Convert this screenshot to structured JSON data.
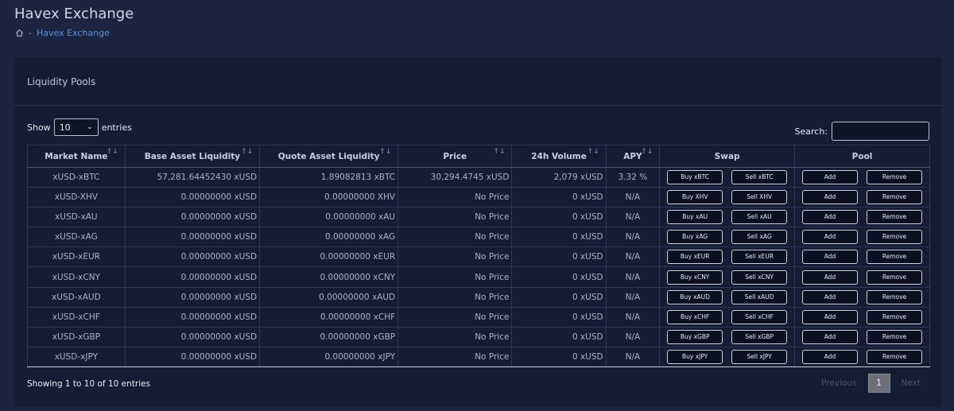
{
  "page": {
    "title": "Havex Exchange"
  },
  "breadcrumb": {
    "home_icon": "home-icon",
    "separator": "-",
    "current": "Havex Exchange"
  },
  "card": {
    "title": "Liquidity Pools"
  },
  "length": {
    "show_label": "Show",
    "value": "10",
    "entries_label": "entries"
  },
  "search": {
    "label": "Search:",
    "value": ""
  },
  "table": {
    "headers": [
      "Market Name",
      "Base Asset Liquidity",
      "Quote Asset Liquidity",
      "Price",
      "24h Volume",
      "APY",
      "Swap",
      "Pool"
    ],
    "sort_glyphs": [
      "↑↓",
      "↑↓",
      "↑↓",
      "↑↓",
      "↑↓",
      "↑↓"
    ],
    "rows": [
      {
        "market": "xUSD-xBTC",
        "base": "57,281.64452430 xUSD",
        "quote": "1.89082813 xBTC",
        "price": "30,294.4745 xUSD",
        "volume": "2,079 xUSD",
        "apy": "3.32 %",
        "buy": "Buy xBTC",
        "sell": "Sell xBTC",
        "add": "Add",
        "remove": "Remove"
      },
      {
        "market": "xUSD-XHV",
        "base": "0.00000000 xUSD",
        "quote": "0.00000000 XHV",
        "price": "No Price",
        "volume": "0 xUSD",
        "apy": "N/A",
        "buy": "Buy XHV",
        "sell": "Sell XHV",
        "add": "Add",
        "remove": "Remove"
      },
      {
        "market": "xUSD-xAU",
        "base": "0.00000000 xUSD",
        "quote": "0.00000000 xAU",
        "price": "No Price",
        "volume": "0 xUSD",
        "apy": "N/A",
        "buy": "Buy xAU",
        "sell": "Sell xAU",
        "add": "Add",
        "remove": "Remove"
      },
      {
        "market": "xUSD-xAG",
        "base": "0.00000000 xUSD",
        "quote": "0.00000000 xAG",
        "price": "No Price",
        "volume": "0 xUSD",
        "apy": "N/A",
        "buy": "Buy xAG",
        "sell": "Sell xAG",
        "add": "Add",
        "remove": "Remove"
      },
      {
        "market": "xUSD-xEUR",
        "base": "0.00000000 xUSD",
        "quote": "0.00000000 xEUR",
        "price": "No Price",
        "volume": "0 xUSD",
        "apy": "N/A",
        "buy": "Buy xEUR",
        "sell": "Sell xEUR",
        "add": "Add",
        "remove": "Remove"
      },
      {
        "market": "xUSD-xCNY",
        "base": "0.00000000 xUSD",
        "quote": "0.00000000 xCNY",
        "price": "No Price",
        "volume": "0 xUSD",
        "apy": "N/A",
        "buy": "Buy xCNY",
        "sell": "Sell xCNY",
        "add": "Add",
        "remove": "Remove"
      },
      {
        "market": "xUSD-xAUD",
        "base": "0.00000000 xUSD",
        "quote": "0.00000000 xAUD",
        "price": "No Price",
        "volume": "0 xUSD",
        "apy": "N/A",
        "buy": "Buy xAUD",
        "sell": "Sell xAUD",
        "add": "Add",
        "remove": "Remove"
      },
      {
        "market": "xUSD-xCHF",
        "base": "0.00000000 xUSD",
        "quote": "0.00000000 xCHF",
        "price": "No Price",
        "volume": "0 xUSD",
        "apy": "N/A",
        "buy": "Buy xCHF",
        "sell": "Sell xCHF",
        "add": "Add",
        "remove": "Remove"
      },
      {
        "market": "xUSD-xGBP",
        "base": "0.00000000 xUSD",
        "quote": "0.00000000 xGBP",
        "price": "No Price",
        "volume": "0 xUSD",
        "apy": "N/A",
        "buy": "Buy xGBP",
        "sell": "Sell xGBP",
        "add": "Add",
        "remove": "Remove"
      },
      {
        "market": "xUSD-xJPY",
        "base": "0.00000000 xUSD",
        "quote": "0.00000000 xJPY",
        "price": "No Price",
        "volume": "0 xUSD",
        "apy": "N/A",
        "buy": "Buy xJPY",
        "sell": "Sell xJPY",
        "add": "Add",
        "remove": "Remove"
      }
    ]
  },
  "footer": {
    "info": "Showing 1 to 10 of 10 entries"
  },
  "pagination": {
    "previous": "Previous",
    "current_page": "1",
    "next": "Next"
  },
  "colors": {
    "background": "#1b2540",
    "card": "#141d34",
    "link": "#5d8fdc",
    "active_page": "#6c6f78"
  }
}
